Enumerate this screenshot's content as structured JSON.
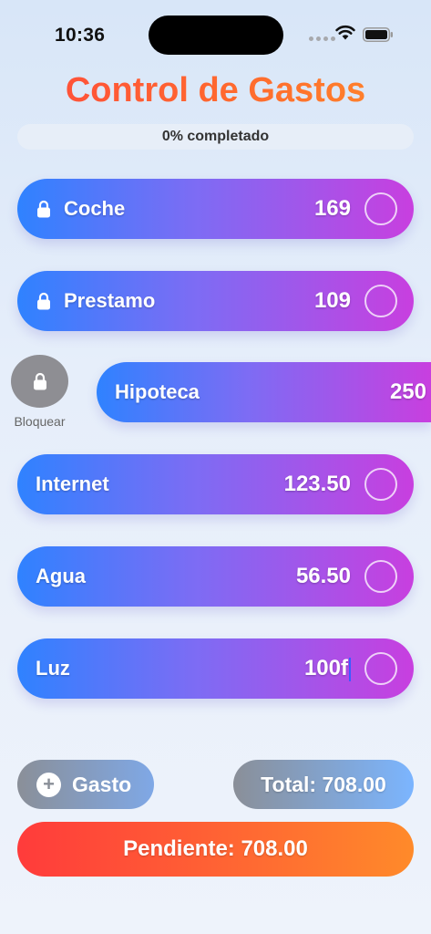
{
  "status_bar": {
    "time": "10:36"
  },
  "title": "Control de Gastos",
  "progress": {
    "label": "0% completado",
    "percent": 0
  },
  "expenses": [
    {
      "name": "Coche",
      "amount": "169",
      "locked": true
    },
    {
      "name": "Prestamo",
      "amount": "109",
      "locked": true
    },
    {
      "name": "Hipoteca",
      "amount": "250",
      "locked": false
    },
    {
      "name": "Internet",
      "amount": "123.50",
      "locked": false
    },
    {
      "name": "Agua",
      "amount": "56.50",
      "locked": false
    },
    {
      "name": "Luz",
      "amount": "100f",
      "locked": false
    }
  ],
  "swipe_action": {
    "label": "Bloquear"
  },
  "add_button": {
    "label": "Gasto"
  },
  "total": "Total: 708.00",
  "pending": "Pendiente: 708.00",
  "colors": {
    "title": "#ff5a34",
    "row_start": "#2f82ff",
    "row_end": "#c83fdf",
    "pending_start": "#ff3b3b",
    "pending_end": "#ff8a2a"
  }
}
